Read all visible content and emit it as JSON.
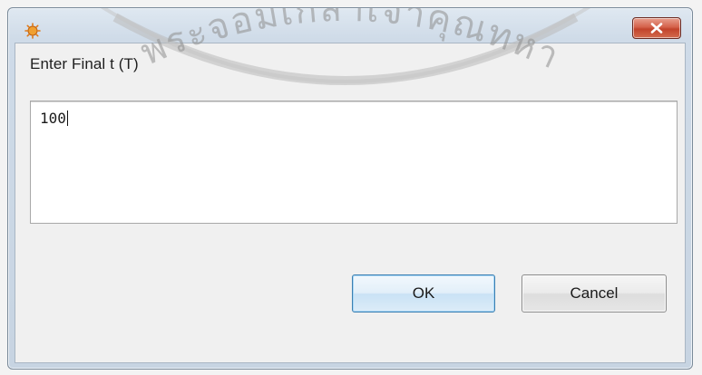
{
  "dialog": {
    "app_icon": "java-applet-icon",
    "close_icon": "close-icon",
    "prompt": "Enter Final t (T)",
    "input_value": "100",
    "ok_label": "OK",
    "cancel_label": "Cancel",
    "accent_color": "#c2432b"
  },
  "watermark": {
    "text": "มหาวิทยาลัยพระจอมเกล้าเจ้าคุณทหารลาดกระบัง"
  }
}
